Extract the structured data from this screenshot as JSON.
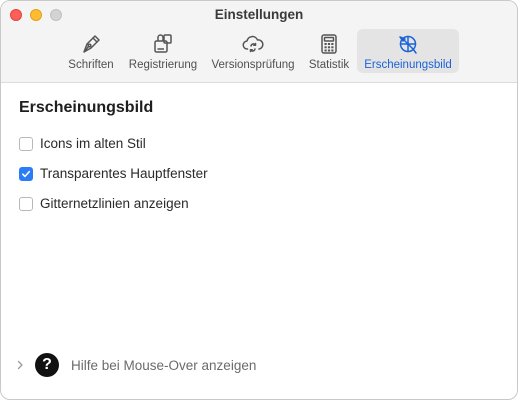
{
  "window": {
    "title": "Einstellungen"
  },
  "toolbar": {
    "items": [
      {
        "label": "Schriften",
        "icon": "pen-nib-icon"
      },
      {
        "label": "Registrierung",
        "icon": "registration-icon"
      },
      {
        "label": "Versionsprüfung",
        "icon": "cloud-sync-icon"
      },
      {
        "label": "Statistik",
        "icon": "calculator-icon"
      },
      {
        "label": "Erscheinungsbild",
        "icon": "appearance-icon",
        "active": true
      }
    ]
  },
  "section": {
    "title": "Erscheinungsbild"
  },
  "options": [
    {
      "label": "Icons im alten Stil",
      "checked": false
    },
    {
      "label": "Transparentes Hauptfenster",
      "checked": true
    },
    {
      "label": "Gitternetzlinien anzeigen",
      "checked": false
    }
  ],
  "help": {
    "label": "Hilfe bei Mouse-Over anzeigen",
    "icon_glyph": "?"
  },
  "colors": {
    "accent": "#2a7cf7",
    "active_label": "#1a63d9",
    "toolbar_active_bg": "#e4e4e4"
  }
}
